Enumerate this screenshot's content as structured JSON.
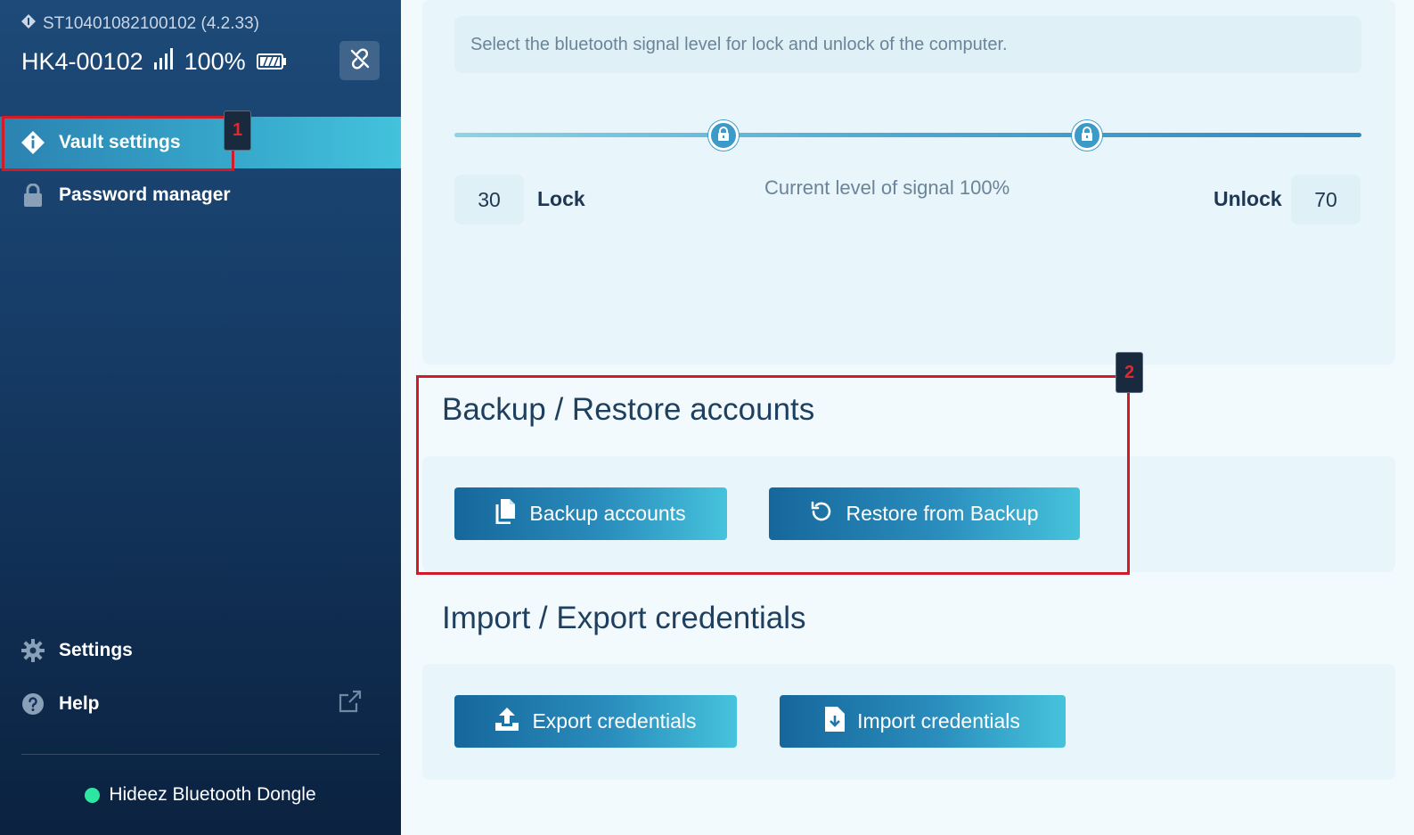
{
  "device": {
    "serial": "ST10401082100102 (4.2.33)",
    "name": "HK4-00102",
    "battery": "100%"
  },
  "nav": {
    "vault_settings": "Vault settings",
    "password_manager": "Password manager",
    "settings": "Settings",
    "help": "Help"
  },
  "dongle": {
    "label": "Hideez Bluetooth Dongle",
    "status_color": "#2ee6a2"
  },
  "annotations": {
    "mark1": "1",
    "mark2": "2"
  },
  "proximity": {
    "hint": "Select the bluetooth signal level for lock and unlock of the computer.",
    "lock_value": "30",
    "lock_label": "Lock",
    "unlock_value": "70",
    "unlock_label": "Unlock",
    "signal_text": "Current level of signal 100%",
    "lock_level_pct": 30,
    "unlock_level_pct": 70
  },
  "backup": {
    "title": "Backup / Restore accounts",
    "backup_button": "Backup accounts",
    "restore_button": "Restore from Backup"
  },
  "import_export": {
    "title": "Import / Export credentials",
    "export_button": "Export credentials",
    "import_button": "Import credentials"
  },
  "colors": {
    "accent": "#37a9cc",
    "sidebar": "#173e69",
    "annotation": "#d11c28"
  }
}
